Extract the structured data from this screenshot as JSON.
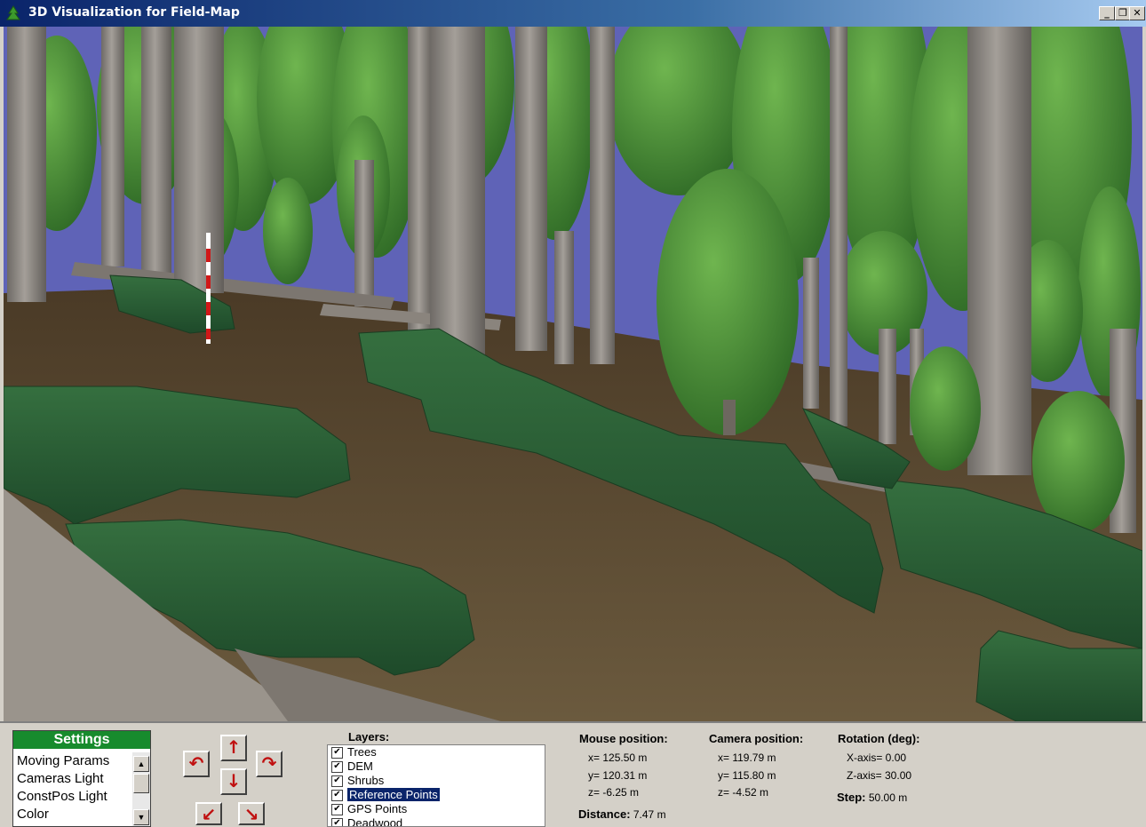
{
  "window": {
    "title": "3D Visualization for Field-Map",
    "minimize": "_",
    "restore": "❐",
    "close": "✕"
  },
  "settings": {
    "header": "Settings",
    "items": [
      "Moving Params",
      "Cameras Light",
      "ConstPos Light",
      "Color"
    ]
  },
  "navigation": {
    "rotate_left": "↶",
    "forward": "↑",
    "rotate_right": "↷",
    "back": "↓",
    "down_left": "↙",
    "down_right": "↘"
  },
  "layers": {
    "label": "Layers:",
    "items": [
      {
        "name": "Trees",
        "checked": true
      },
      {
        "name": "DEM",
        "checked": true
      },
      {
        "name": "Shrubs",
        "checked": true
      },
      {
        "name": "Reference Points",
        "checked": true,
        "selected": true
      },
      {
        "name": "GPS Points",
        "checked": true
      },
      {
        "name": "Deadwood",
        "checked": true
      }
    ]
  },
  "mouse_position": {
    "label": "Mouse position:",
    "x": "x= 125.50 m",
    "y": "y= 120.31 m",
    "z": "z= -6.25 m"
  },
  "distance": {
    "label": "Distance:",
    "value": "7.47 m"
  },
  "camera_position": {
    "label": "Camera position:",
    "x": "x= 119.79 m",
    "y": "y= 115.80 m",
    "z": "z= -4.52 m"
  },
  "rotation": {
    "label": "Rotation (deg):",
    "x_axis": "X-axis= 0.00",
    "z_axis": "Z-axis= 30.00"
  },
  "step": {
    "label": "Step:",
    "value": "50.00 m"
  },
  "colors": {
    "sky": "#5f63b7",
    "crown": "#4f9a3c",
    "trunk": "#8f8983",
    "ground": "#5c4a30",
    "shrub": "#2f6a3c",
    "settings_header": "#178b2d"
  }
}
